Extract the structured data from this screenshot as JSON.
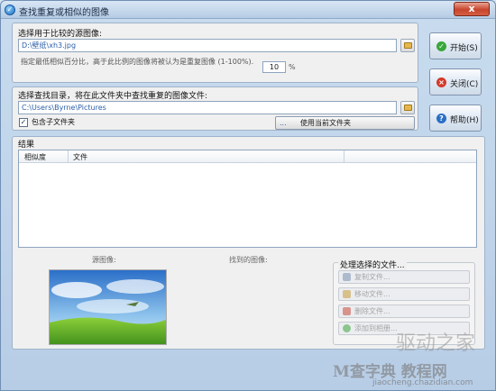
{
  "window": {
    "title": "查找重复或相似的图像",
    "close": "x"
  },
  "source": {
    "group_title": "选择用于比较的源图像:",
    "path": "D:\\壁纸\\xh3.jpg",
    "note": "指定最低相似百分比，高于此比例的图像将被认为是重复图像 (1-100%).",
    "percent_value": "10",
    "percent_unit": "%"
  },
  "folder": {
    "group_title": "选择查找目录，将在此文件夹中查找重复的图像文件:",
    "path": "C:\\Users\\Byrne\\Pictures",
    "include_subfolders_label": "包含子文件夹",
    "include_subfolders_checked": "✓",
    "use_current_dots": "...",
    "use_current_label": "使用当前文件夹"
  },
  "buttons": {
    "start": "开始(S)",
    "close": "关闭(C)",
    "help": "帮助(H)"
  },
  "results": {
    "group_title": "结果",
    "columns": [
      "相似度",
      "文件"
    ],
    "source_image_caption": "源图像:",
    "found_image_caption": "找到的图像:"
  },
  "actions": {
    "title": "处理选择的文件...",
    "items": [
      "复制文件...",
      "移动文件...",
      "删除文件...",
      "添加到相册..."
    ]
  },
  "watermark": {
    "brand": "驱动之家",
    "site_big": "M查字典 教程网",
    "url": "jiaocheng.chazidian.com"
  },
  "colors": {
    "accent": "#2b5fa8",
    "start_icon": "#3aa63a",
    "close_icon": "#d33a2a",
    "help_icon": "#2a6fc5"
  }
}
